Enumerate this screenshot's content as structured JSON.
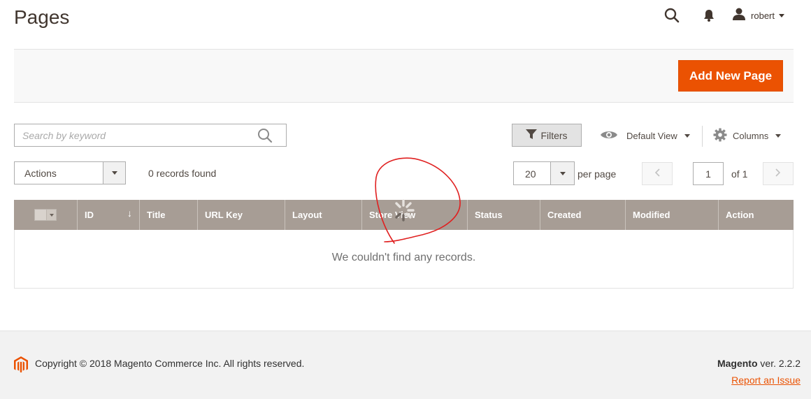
{
  "page": {
    "title": "Pages"
  },
  "header": {
    "user_name": "robert"
  },
  "toolbar": {
    "add_label": "Add New Page"
  },
  "search": {
    "placeholder": "Search by keyword",
    "value": ""
  },
  "filters": {
    "label": "Filters"
  },
  "view": {
    "label": "Default View"
  },
  "columns": {
    "label": "Columns"
  },
  "mass_actions": {
    "label": "Actions"
  },
  "records": {
    "found_label": "0 records found"
  },
  "pagination": {
    "per_page_value": "20",
    "per_page_label": "per page",
    "current_page": "1",
    "total_label": "of 1"
  },
  "grid": {
    "columns": [
      {
        "label": "ID"
      },
      {
        "label": "Title"
      },
      {
        "label": "URL Key"
      },
      {
        "label": "Layout"
      },
      {
        "label": "Store View"
      },
      {
        "label": "Status"
      },
      {
        "label": "Created"
      },
      {
        "label": "Modified"
      },
      {
        "label": "Action"
      }
    ],
    "sort_indicator": "↓",
    "empty_message": "We couldn't find any records."
  },
  "footer": {
    "copyright": "Copyright © 2018 Magento Commerce Inc. All rights reserved.",
    "brand": "Magento",
    "version": "ver. 2.2.2",
    "report_link": "Report an Issue"
  },
  "colors": {
    "accent": "#eb5202",
    "grid_header": "#a79d95",
    "annotation": "#e02020"
  }
}
